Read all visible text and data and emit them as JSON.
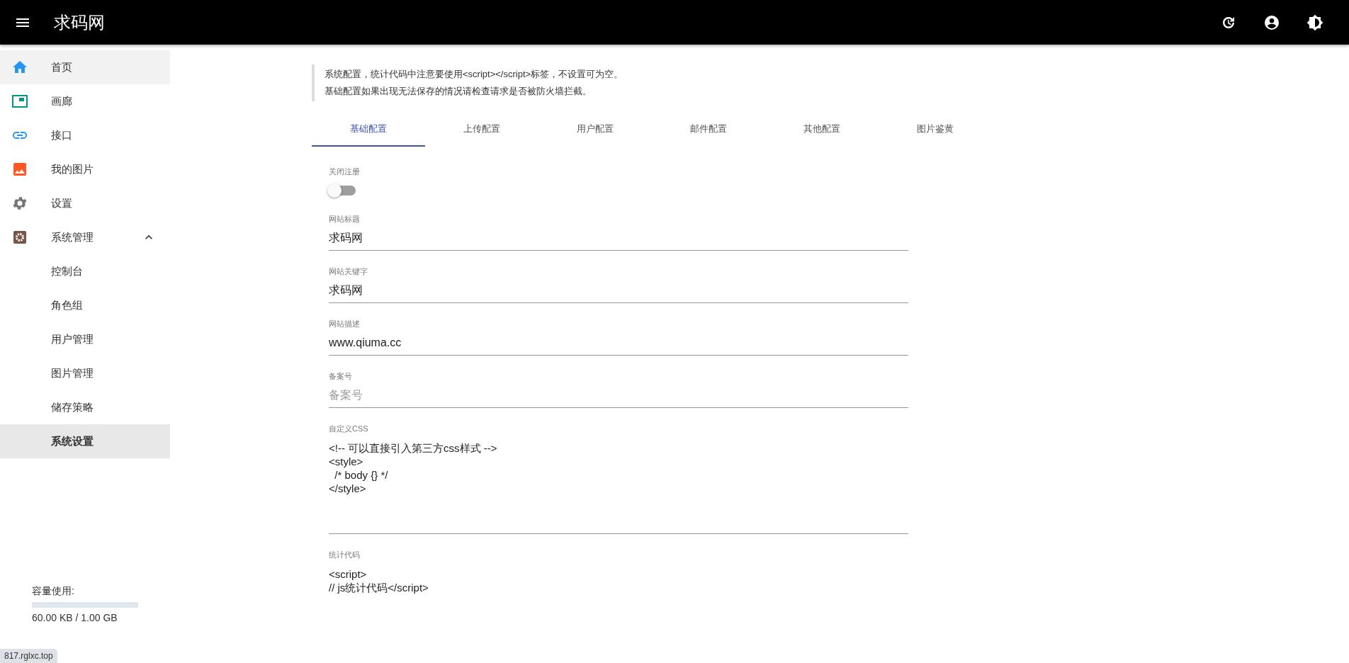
{
  "app_bar": {
    "title": "求码网"
  },
  "sidebar": {
    "items": [
      {
        "label": "首页",
        "color": "#2196f3",
        "hovered": true,
        "selected": false
      },
      {
        "label": "画廊",
        "color": "#009688",
        "hovered": false,
        "selected": false
      },
      {
        "label": "接口",
        "color": "#2196f3",
        "hovered": false,
        "selected": false
      },
      {
        "label": "我的图片",
        "color": "#ff5722",
        "hovered": false,
        "selected": false
      },
      {
        "label": "设置",
        "color": "#757575",
        "hovered": false,
        "selected": false
      },
      {
        "label": "系统管理",
        "color": "#795548",
        "hovered": false,
        "selected": false,
        "expanded": true,
        "children": [
          {
            "label": "控制台",
            "selected": false
          },
          {
            "label": "角色组",
            "selected": false
          },
          {
            "label": "用户管理",
            "selected": false
          },
          {
            "label": "图片管理",
            "selected": false
          },
          {
            "label": "储存策略",
            "selected": false
          },
          {
            "label": "系统设置",
            "selected": true
          }
        ]
      }
    ],
    "storage": {
      "label": "容量使用:",
      "reading": "60.00 KB / 1.00 GB"
    }
  },
  "notice": [
    "系统配置，统计代码中注意要使用<script></script>标签，不设置可为空。",
    "基础配置如果出现无法保存的情况请检查请求是否被防火墙拦截。"
  ],
  "tabs": [
    {
      "label": "基础配置",
      "selected": true
    },
    {
      "label": "上传配置",
      "selected": false
    },
    {
      "label": "用户配置",
      "selected": false
    },
    {
      "label": "邮件配置",
      "selected": false
    },
    {
      "label": "其他配置",
      "selected": false
    },
    {
      "label": "图片鉴黄",
      "selected": false
    }
  ],
  "fields": [
    {
      "kind": "switch",
      "label": "关闭注册",
      "on": false
    },
    {
      "kind": "text",
      "label": "网站标题",
      "value": "求码网"
    },
    {
      "kind": "text",
      "label": "网站关键字",
      "value": "求码网"
    },
    {
      "kind": "text",
      "label": "网站描述",
      "value": "www.qiuma.cc"
    },
    {
      "kind": "text",
      "label": "备案号",
      "placeholder": "备案号"
    },
    {
      "kind": "textarea",
      "label": "自定义CSS",
      "value": "<!-- 可以直接引入第三方css样式 -->\n<style>\n  /* body {} */\n</style>",
      "underline": true
    },
    {
      "kind": "textarea",
      "label": "统计代码",
      "value": "<script>\n// js统计代码</script>",
      "underline": false
    }
  ],
  "status_link": "817.rglxc.top"
}
